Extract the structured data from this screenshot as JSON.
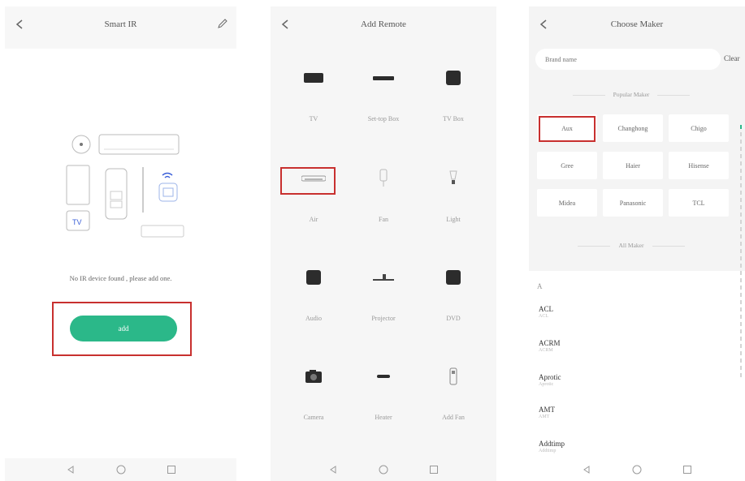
{
  "screen1": {
    "title": "Smart IR",
    "empty_message": "No IR device found , please add one.",
    "add_label": "add",
    "illustration_tv_label": "TV"
  },
  "screen2": {
    "title": "Add Remote",
    "devices": [
      {
        "label": "TV",
        "icon": "tv-icon"
      },
      {
        "label": "Set-top Box",
        "icon": "set-top-box-icon"
      },
      {
        "label": "TV Box",
        "icon": "tv-box-icon"
      },
      {
        "label": "Air",
        "icon": "air-conditioner-icon"
      },
      {
        "label": "Fan",
        "icon": "fan-icon"
      },
      {
        "label": "Light",
        "icon": "light-icon"
      },
      {
        "label": "Audio",
        "icon": "audio-icon"
      },
      {
        "label": "Projector",
        "icon": "projector-icon"
      },
      {
        "label": "DVD",
        "icon": "dvd-icon"
      },
      {
        "label": "Camera",
        "icon": "camera-icon"
      },
      {
        "label": "Heater",
        "icon": "heater-icon"
      },
      {
        "label": "Add Fan",
        "icon": "add-fan-icon"
      }
    ]
  },
  "screen3": {
    "title": "Choose Maker",
    "search_placeholder": "Brand name",
    "clear_label": "Clear",
    "popular_header": "Popular Maker",
    "all_header": "All Maker",
    "popular_makers": [
      "Aux",
      "Changhong",
      "Chigo",
      "Gree",
      "Haier",
      "Hisense",
      "Midea",
      "Panasonic",
      "TCL"
    ],
    "letter": "A",
    "all_makers": [
      {
        "name": "ACL",
        "sub": "ACL"
      },
      {
        "name": "ACRM",
        "sub": "ACRM"
      },
      {
        "name": "Aprotic",
        "sub": "Aprotic"
      },
      {
        "name": "AMT",
        "sub": "AMT"
      },
      {
        "name": "Addtimp",
        "sub": "Addtimp"
      }
    ]
  },
  "colors": {
    "accent": "#2bb889",
    "highlight": "#c8302f"
  }
}
